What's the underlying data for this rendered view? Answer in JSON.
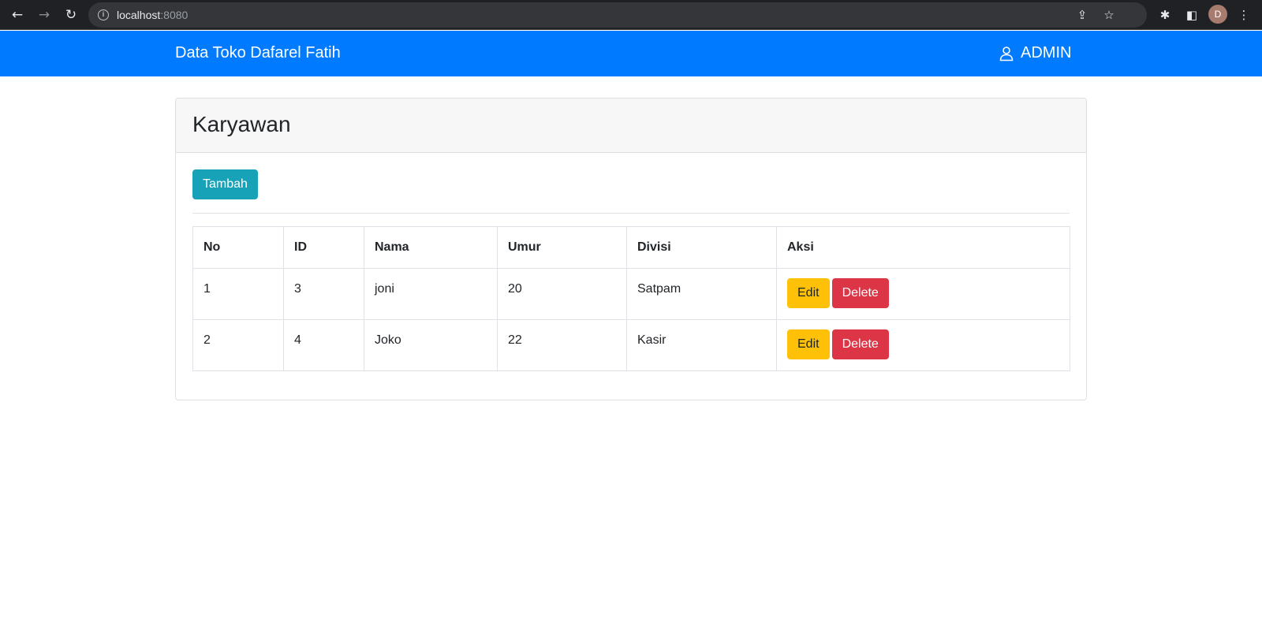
{
  "browser": {
    "url_host": "localhost",
    "url_port": ":8080",
    "profile_initial": "D"
  },
  "navbar": {
    "brand": "Data Toko Dafarel Fatih",
    "user_label": "ADMIN"
  },
  "card": {
    "title": "Karyawan",
    "add_button": "Tambah"
  },
  "table": {
    "headers": [
      "No",
      "ID",
      "Nama",
      "Umur",
      "Divisi",
      "Aksi"
    ],
    "rows": [
      {
        "no": "1",
        "id": "3",
        "nama": "joni",
        "umur": "20",
        "divisi": "Satpam",
        "edit": "Edit",
        "delete": "Delete"
      },
      {
        "no": "2",
        "id": "4",
        "nama": "Joko",
        "umur": "22",
        "divisi": "Kasir",
        "edit": "Edit",
        "delete": "Delete"
      }
    ]
  },
  "colors": {
    "navbar": "#007bff",
    "add_button": "#17a2b8",
    "edit_button": "#ffc107",
    "delete_button": "#dc3545"
  }
}
